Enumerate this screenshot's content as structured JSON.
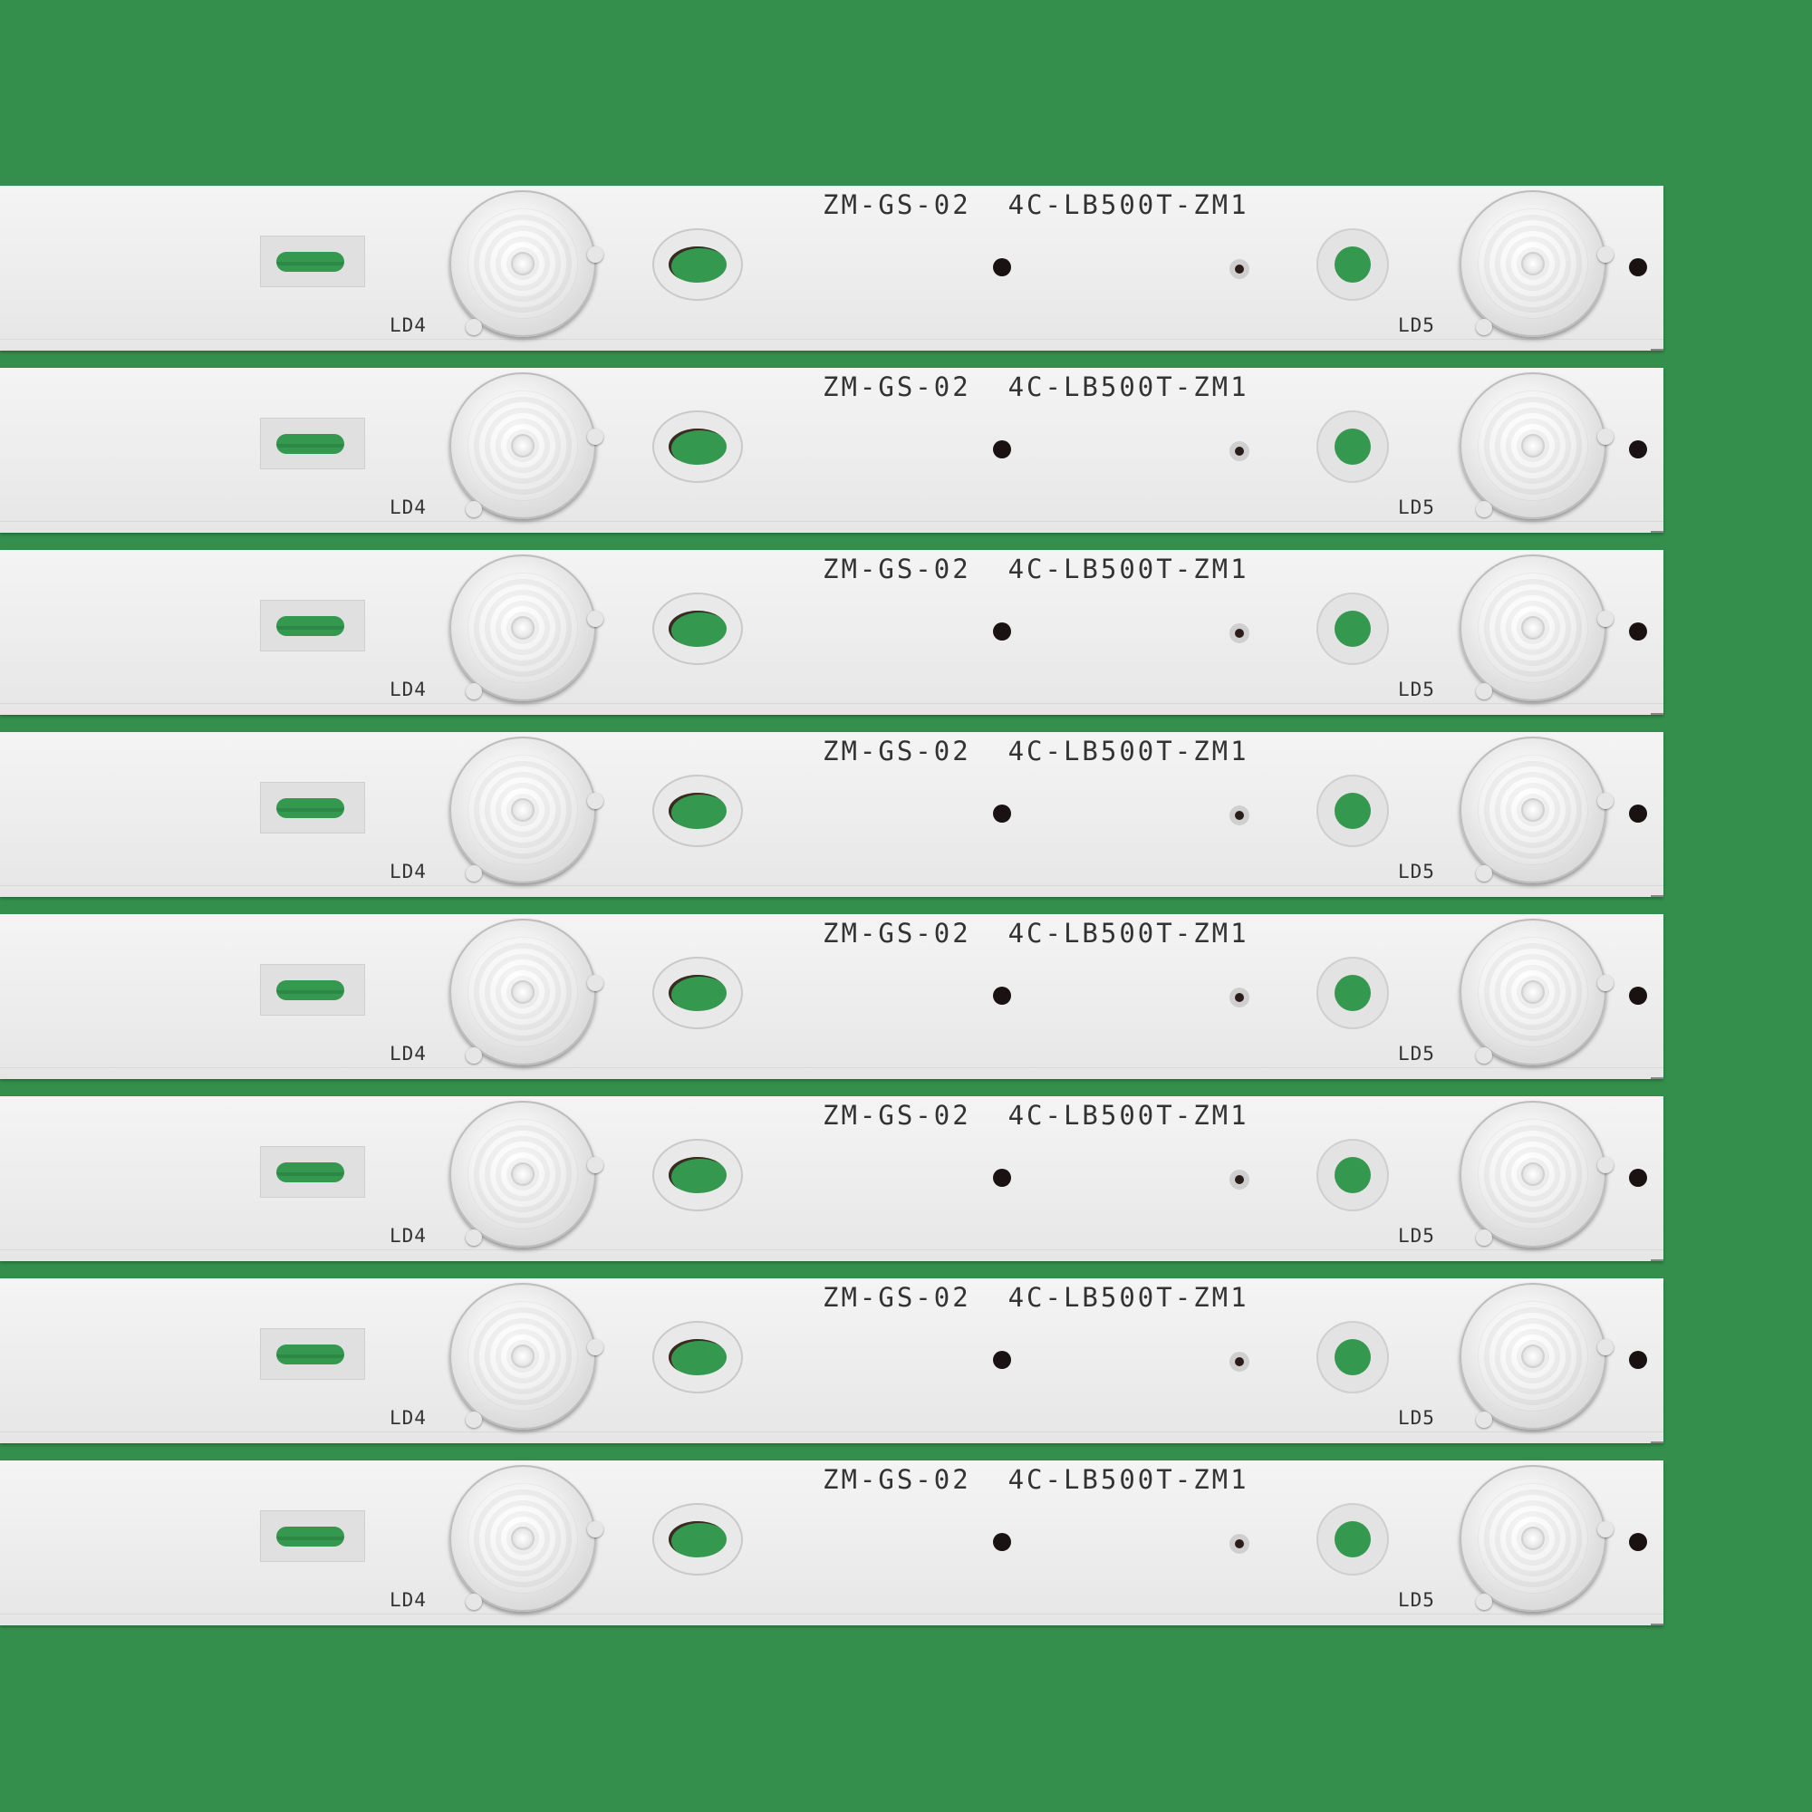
{
  "image": {
    "background_color": "#338F4B",
    "strip_color": "#F0F0F0",
    "hole_color": "#35984F"
  },
  "strips": [
    {
      "model": "ZM-GS-02  4C-LB500T-ZM1",
      "left_label": "LD4",
      "right_label": "LD5"
    },
    {
      "model": "ZM-GS-02  4C-LB500T-ZM1",
      "left_label": "LD4",
      "right_label": "LD5"
    },
    {
      "model": "ZM-GS-02  4C-LB500T-ZM1",
      "left_label": "LD4",
      "right_label": "LD5"
    },
    {
      "model": "ZM-GS-02  4C-LB500T-ZM1",
      "left_label": "LD4",
      "right_label": "LD5"
    },
    {
      "model": "ZM-GS-02  4C-LB500T-ZM1",
      "left_label": "LD4",
      "right_label": "LD5"
    },
    {
      "model": "ZM-GS-02  4C-LB500T-ZM1",
      "left_label": "LD4",
      "right_label": "LD5"
    },
    {
      "model": "ZM-GS-02  4C-LB500T-ZM1",
      "left_label": "LD4",
      "right_label": "LD5"
    },
    {
      "model": "ZM-GS-02  4C-LB500T-ZM1",
      "left_label": "LD4",
      "right_label": "LD5"
    }
  ]
}
